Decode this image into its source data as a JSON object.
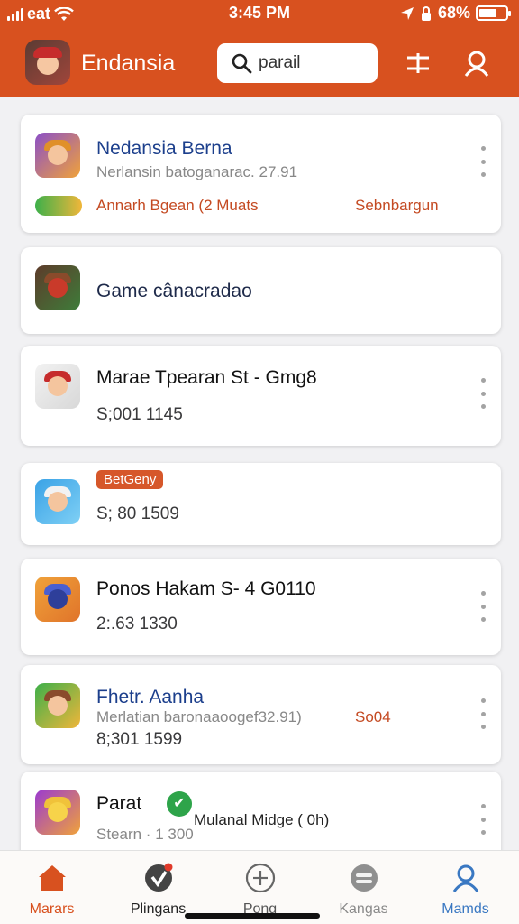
{
  "status_bar": {
    "carrier": "eat",
    "time": "3:45 PM",
    "battery": "68%",
    "battery_level": 0.68
  },
  "header": {
    "app_title": "Endansia",
    "search": {
      "value": "parail",
      "placeholder": ""
    },
    "icons": {
      "logo": "game-logo",
      "search": "search-icon",
      "filter": "filter-icon",
      "profile": "profile-icon"
    }
  },
  "cards": [
    {
      "title": "Nedansia Berna",
      "subtitle": "Nerlansin batoganarac. 27.91",
      "promo_left": "Annarh Bgean (2 Muats",
      "promo_right": "Sebnbargun",
      "icon": "game-thumb-icon"
    },
    {
      "title": "Game cânacradao",
      "icon": "game-thumb-icon"
    },
    {
      "title": "Marae Tpearan St - Gmg8",
      "price": "S;001 1145",
      "icon": "game-thumb-icon"
    },
    {
      "tag": "BetGeny",
      "price": "S; 80 1509",
      "icon": "game-thumb-icon"
    },
    {
      "title": "Ponos Hakam S- 4 G0110",
      "price": "2:.63 1330",
      "icon": "game-thumb-icon"
    },
    {
      "title": "Fhetr. Aanha",
      "subtitle": "Merlatian baronaaoogef32.91)",
      "tag_right": "So04",
      "price": "8;301 1599",
      "icon": "game-thumb-icon"
    },
    {
      "title": "Parat",
      "subtitle_right": "Mulanal Midge ( 0h)",
      "sub": "Stearn · 1 300",
      "icon": "game-thumb-icon"
    }
  ],
  "bottom_nav": [
    {
      "label": "Marars",
      "icon": "home-icon",
      "color": "#d8511f"
    },
    {
      "label": "Plingans",
      "icon": "shield-icon",
      "color": "#222222"
    },
    {
      "label": "Pong",
      "icon": "plus-circle-icon",
      "color": "#555555"
    },
    {
      "label": "Kangas",
      "icon": "gamepad-icon",
      "color": "#8a8a8a"
    },
    {
      "label": "Mamds",
      "icon": "profile-icon",
      "color": "#3a78c2"
    }
  ],
  "colors": {
    "brand": "#d8511f",
    "title_blue": "#1c3f8c",
    "promo": "#c44a22",
    "tag": "#d6572a"
  }
}
